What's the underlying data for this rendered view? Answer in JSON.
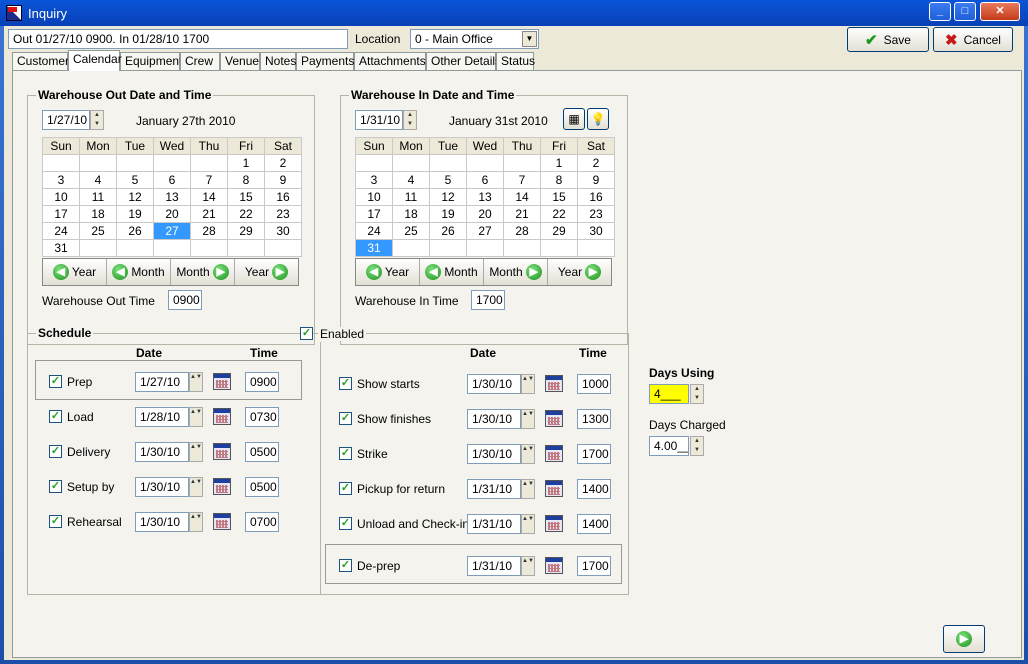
{
  "window": {
    "title": "Inquiry",
    "minimize": "_",
    "maximize": "□",
    "close": "✕"
  },
  "header": {
    "summary": "Out 01/27/10 0900.  In 01/28/10 1700",
    "location_label": "Location",
    "location_value": "0 - Main Office",
    "save_label": "Save",
    "cancel_label": "Cancel"
  },
  "tabs": [
    "Customer",
    "Calendar",
    "Equipment",
    "Crew",
    "Venue",
    "Notes",
    "Payments",
    "Attachments",
    "Other Details",
    "Status"
  ],
  "out_calendar": {
    "title": "Warehouse Out Date and Time",
    "date_value": "1/27/10",
    "date_long": "January 27th 2010",
    "days": [
      "Sun",
      "Mon",
      "Tue",
      "Wed",
      "Thu",
      "Fri",
      "Sat"
    ],
    "weeks": [
      [
        "",
        "",
        "",
        "",
        "",
        "1",
        "2"
      ],
      [
        "3",
        "4",
        "5",
        "6",
        "7",
        "8",
        "9"
      ],
      [
        "10",
        "11",
        "12",
        "13",
        "14",
        "15",
        "16"
      ],
      [
        "17",
        "18",
        "19",
        "20",
        "21",
        "22",
        "23"
      ],
      [
        "24",
        "25",
        "26",
        "27",
        "28",
        "29",
        "30"
      ],
      [
        "31",
        "",
        "",
        "",
        "",
        "",
        ""
      ]
    ],
    "selected": "27",
    "nav": [
      "Year",
      "Month",
      "Month",
      "Year"
    ],
    "time_label": "Warehouse Out Time",
    "time_value": "0900"
  },
  "in_calendar": {
    "title": "Warehouse In Date and Time",
    "date_value": "1/31/10",
    "date_long": "January 31st 2010",
    "days": [
      "Sun",
      "Mon",
      "Tue",
      "Wed",
      "Thu",
      "Fri",
      "Sat"
    ],
    "weeks": [
      [
        "",
        "",
        "",
        "",
        "",
        "1",
        "2"
      ],
      [
        "3",
        "4",
        "5",
        "6",
        "7",
        "8",
        "9"
      ],
      [
        "10",
        "11",
        "12",
        "13",
        "14",
        "15",
        "16"
      ],
      [
        "17",
        "18",
        "19",
        "20",
        "21",
        "22",
        "23"
      ],
      [
        "24",
        "25",
        "26",
        "27",
        "28",
        "29",
        "30"
      ],
      [
        "31",
        "",
        "",
        "",
        "",
        "",
        ""
      ]
    ],
    "selected": "31",
    "nav": [
      "Year",
      "Month",
      "Month",
      "Year"
    ],
    "time_label": "Warehouse In Time",
    "time_value": "1700"
  },
  "schedule": {
    "title": "Schedule",
    "enabled_label": "Enabled",
    "date_header": "Date",
    "time_header": "Time",
    "left_items": [
      {
        "label": "Prep",
        "date": "1/27/10",
        "time": "0900"
      },
      {
        "label": "Load",
        "date": "1/28/10",
        "time": "0730"
      },
      {
        "label": "Delivery",
        "date": "1/30/10",
        "time": "0500"
      },
      {
        "label": "Setup by",
        "date": "1/30/10",
        "time": "0500"
      },
      {
        "label": "Rehearsal",
        "date": "1/30/10",
        "time": "0700"
      }
    ],
    "right_items": [
      {
        "label": "Show starts",
        "date": "1/30/10",
        "time": "1000"
      },
      {
        "label": "Show finishes",
        "date": "1/30/10",
        "time": "1300"
      },
      {
        "label": "Strike",
        "date": "1/30/10",
        "time": "1700"
      },
      {
        "label": "Pickup for return",
        "date": "1/31/10",
        "time": "1400"
      },
      {
        "label": "Unload and Check-in",
        "date": "1/31/10",
        "time": "1400"
      },
      {
        "label": "De-prep",
        "date": "1/31/10",
        "time": "1700"
      }
    ]
  },
  "days": {
    "using_label": "Days Using",
    "using_value": "4___",
    "charged_label": "Days Charged",
    "charged_value": "4.00__"
  },
  "colors": {
    "selected_day": "#3399ff",
    "days_using_bg": "#ffff00",
    "titlebar": "#0a55d8"
  }
}
